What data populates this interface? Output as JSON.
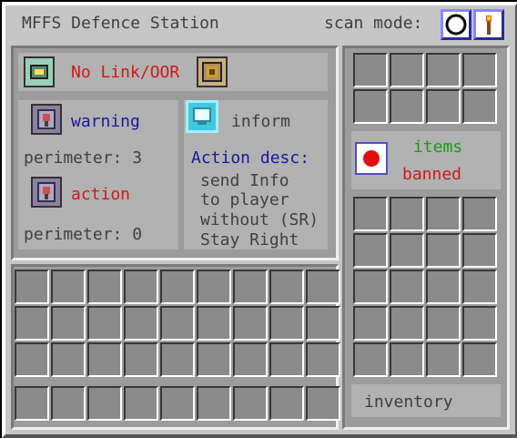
{
  "window": {
    "title": "MFFS Defence Station"
  },
  "scan_mode": {
    "label": "scan mode:",
    "icons": [
      "circle-icon",
      "torch-icon"
    ]
  },
  "link": {
    "status": "No Link/OOR"
  },
  "warning": {
    "label": "warning",
    "perimeter": "perimeter: 3"
  },
  "action": {
    "label": "action",
    "perimeter": "perimeter: 0"
  },
  "inform": {
    "label": "inform",
    "desc_title": "Action desc:",
    "desc_lines": [
      "send Info",
      "to player",
      "without (SR)",
      "Stay Right"
    ]
  },
  "items_filter": {
    "line1": "items",
    "line2": "banned"
  },
  "inventory": {
    "label": "inventory"
  },
  "colors": {
    "red": "#d01818",
    "blue": "#1818a0",
    "green": "#10a010",
    "background": "#c6c6c6"
  }
}
